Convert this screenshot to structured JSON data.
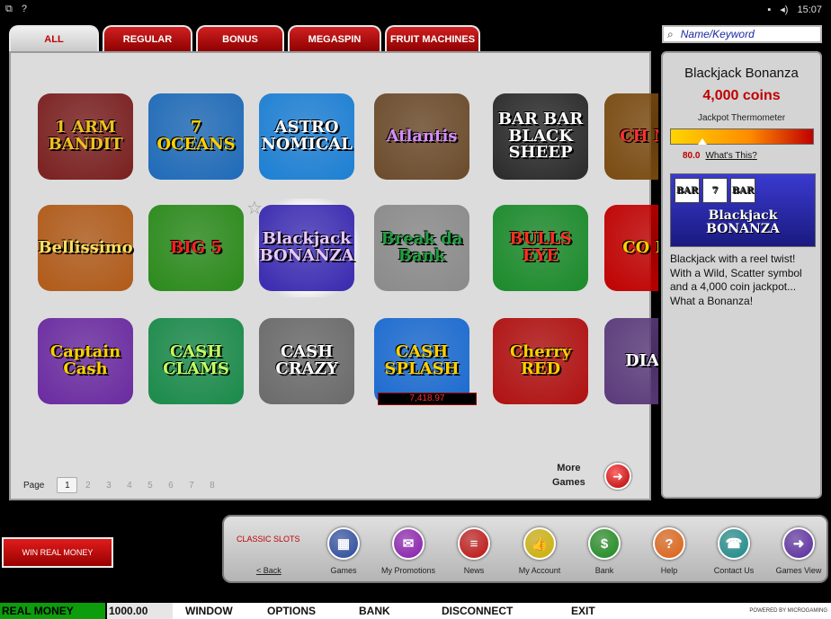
{
  "system": {
    "left_icons": [
      "window-icon",
      "help-icon"
    ],
    "help_glyph": "?",
    "time": "15:07"
  },
  "tabs": [
    {
      "label": "ALL",
      "active": true
    },
    {
      "label": "REGULAR",
      "active": false
    },
    {
      "label": "BONUS",
      "active": false
    },
    {
      "label": "MEGASPIN",
      "active": false
    },
    {
      "label": "FRUIT MACHINES",
      "active": false
    }
  ],
  "games": [
    {
      "label": "1 ARM BANDIT",
      "color": "#7a1f1f",
      "fg": "#f0c020"
    },
    {
      "label": "7 OCEANS",
      "color": "#1e6ab8",
      "fg": "#ffd000"
    },
    {
      "label": "ASTRO NOMICAL",
      "color": "#1c7fd4",
      "fg": "#ffffff"
    },
    {
      "label": "Atlantis",
      "color": "#6b4a2a",
      "fg": "#d68cff"
    },
    {
      "label": "BAR BAR BLACK SHEEP",
      "color": "#2a2a2a",
      "fg": "#ffffff"
    },
    {
      "label": "CH MA",
      "color": "#7a4a10",
      "fg": "#ff3030"
    },
    {
      "label": "Bellissimo",
      "color": "#b05a18",
      "fg": "#ffe060"
    },
    {
      "label": "BIG 5",
      "color": "#2a8a1a",
      "fg": "#ff2020"
    },
    {
      "label": "Blackjack BONANZA",
      "color": "#3a2ab0",
      "fg": "#e6c8ff"
    },
    {
      "label": "Break da Bank",
      "color": "#8a8a8a",
      "fg": "#20a040"
    },
    {
      "label": "BULLS EYE",
      "color": "#1a8a2a",
      "fg": "#ff3020"
    },
    {
      "label": "CO PO",
      "color": "#c00000",
      "fg": "#ffd000"
    },
    {
      "label": "Captain Cash",
      "color": "#6a2aa0",
      "fg": "#ffd000"
    },
    {
      "label": "CASH CLAMS",
      "color": "#1a8a4a",
      "fg": "#c0ff60"
    },
    {
      "label": "CASH CRAZY",
      "color": "#6a6a6a",
      "fg": "#ffffff"
    },
    {
      "label": "CASH SPLASH",
      "color": "#1a6ad0",
      "fg": "#ffd000"
    },
    {
      "label": "Cherry RED",
      "color": "#b01010",
      "fg": "#ffd000"
    },
    {
      "label": "DIA D",
      "color": "#5a3a7a",
      "fg": "#ffffff"
    }
  ],
  "jackpot_ticker": "7,418.97",
  "featured_star": "☆",
  "pager": {
    "label": "Page",
    "pages": [
      "1",
      "2",
      "3",
      "4",
      "5",
      "6",
      "7",
      "8"
    ],
    "current": "1"
  },
  "more_games": {
    "line1": "More",
    "line2": "Games"
  },
  "search": {
    "placeholder": "Name/Keyword"
  },
  "info": {
    "title": "Blackjack Bonanza",
    "coins": "4,000  coins",
    "thermometer_label": "Jackpot Thermometer",
    "thermometer_value": "80.0",
    "thermometer_fraction": 0.22,
    "whats_this": "What's This?",
    "preview_name": "Blackjack BONANZA",
    "description": "Blackjack with a reel twist! With a Wild, Scatter symbol and a 4,000 coin jackpot... What a Bonanza!"
  },
  "win_real_money": "WIN REAL MONEY",
  "nav": {
    "classic_slots": "CLASSIC SLOTS",
    "back": "< Back",
    "items": [
      {
        "label": "Games",
        "icon": "games-icon",
        "glyph": "▦",
        "color": "#2a4aa0"
      },
      {
        "label": "My Promotions",
        "icon": "gift-icon",
        "glyph": "✉",
        "color": "#8a1ab0"
      },
      {
        "label": "News",
        "icon": "news-icon",
        "glyph": "≡",
        "color": "#c01010"
      },
      {
        "label": "My Account",
        "icon": "thumbs-up-icon",
        "glyph": "👍",
        "color": "#d0b000"
      },
      {
        "label": "Bank",
        "icon": "dollar-icon",
        "glyph": "$",
        "color": "#1a8a1a"
      },
      {
        "label": "Help",
        "icon": "help-icon",
        "glyph": "?",
        "color": "#e06010"
      },
      {
        "label": "Contact Us",
        "icon": "phone-icon",
        "glyph": "☎",
        "color": "#1a8a8a"
      },
      {
        "label": "Games View",
        "icon": "games-view-icon",
        "glyph": "➜",
        "color": "#5a2aa0"
      }
    ]
  },
  "status": {
    "mode": "REAL MONEY",
    "balance": "1000.00",
    "menu": [
      "WINDOW",
      "OPTIONS",
      "BANK",
      "DISCONNECT",
      "EXIT"
    ],
    "powered": "POWERED BY MICROGAMING"
  }
}
